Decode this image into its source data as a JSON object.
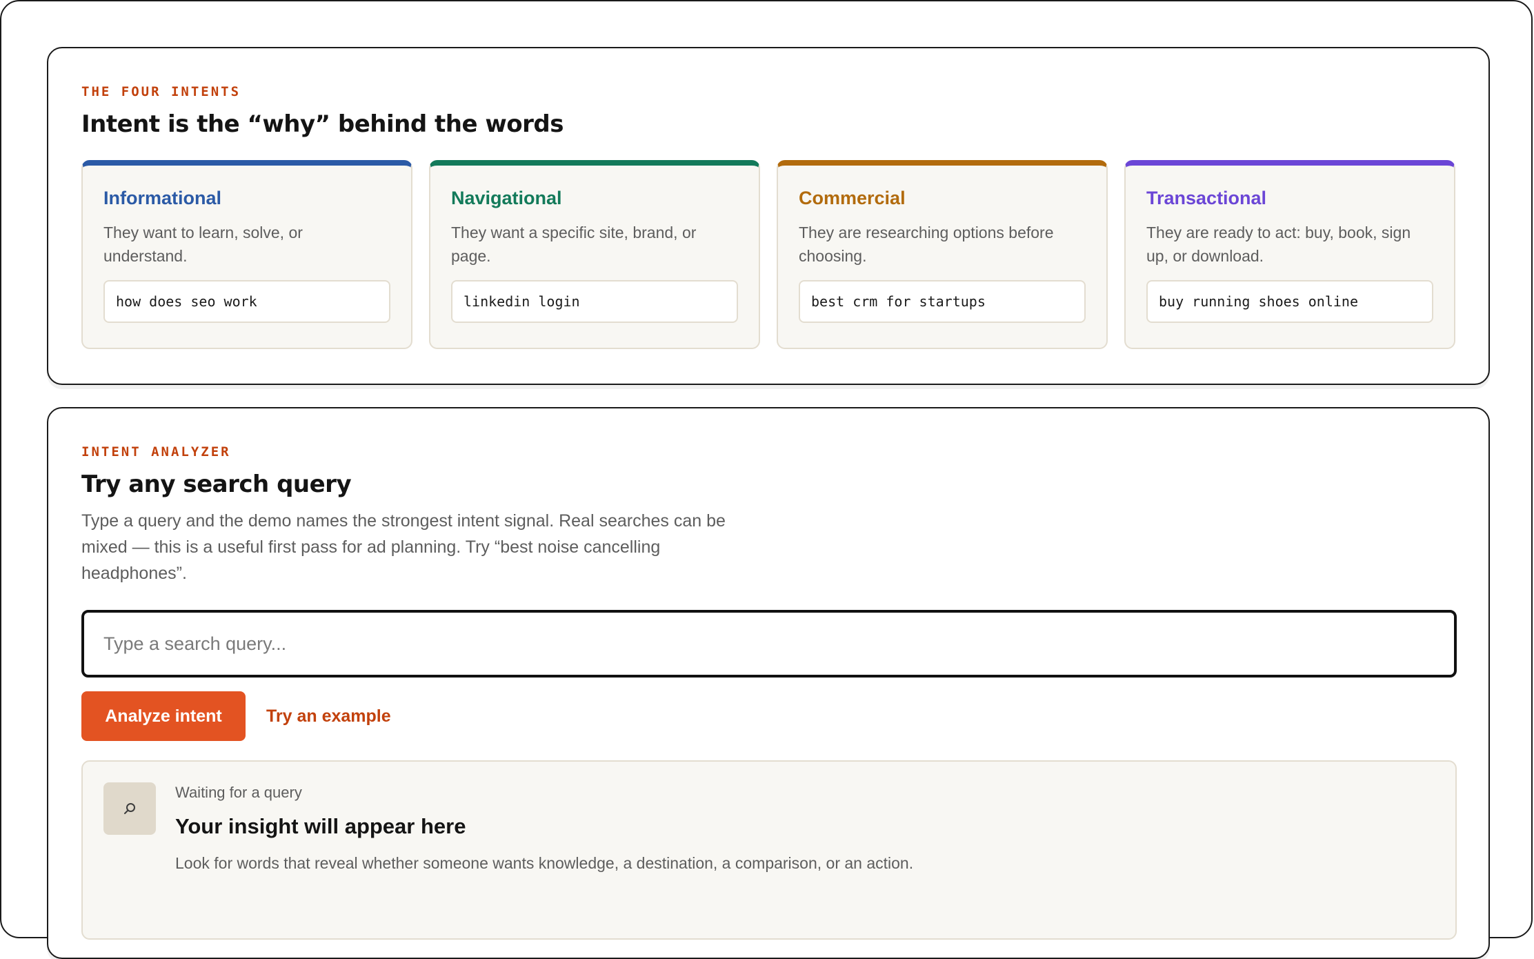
{
  "intents_panel": {
    "eyebrow": "THE FOUR INTENTS",
    "title": "Intent is the “why” behind the words",
    "cards": [
      {
        "title": "Informational",
        "description": "They want to learn, solve, or understand.",
        "example": "how does seo work",
        "color": "#2b5aa6"
      },
      {
        "title": "Navigational",
        "description": "They want a specific site, brand, or page.",
        "example": "linkedin login",
        "color": "#137a5a"
      },
      {
        "title": "Commercial",
        "description": "They are researching options before choosing.",
        "example": "best crm for startups",
        "color": "#b26b0d"
      },
      {
        "title": "Transactional",
        "description": "They are ready to act: buy, book, sign up, or download.",
        "example": "buy running shoes online",
        "color": "#6b46d6"
      }
    ]
  },
  "analyzer_panel": {
    "eyebrow": "INTENT ANALYZER",
    "title": "Try any search query",
    "description": "Type a query and the demo names the strongest intent signal. Real searches can be mixed — this is a useful first pass for ad planning. Try “best noise cancelling headphones”.",
    "search": {
      "placeholder": "Type a search query...",
      "value": ""
    },
    "analyze_label": "Analyze intent",
    "example_label": "Try an example",
    "insight": {
      "icon": "search-icon",
      "status": "Waiting for a query",
      "title": "Your insight will appear here",
      "hint": "Look for words that reveal whether someone wants knowledge, a destination, a comparison, or an action."
    },
    "accent_color": "#e35322"
  }
}
